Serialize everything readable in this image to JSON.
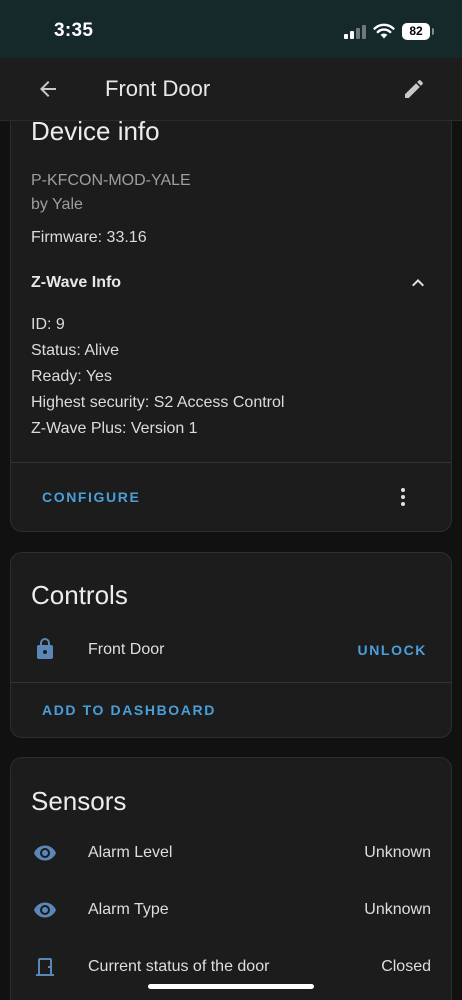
{
  "status_bar": {
    "time": "3:35",
    "battery": "82"
  },
  "app_bar": {
    "title": "Front Door",
    "back_icon": "arrow-left-icon",
    "edit_icon": "pencil-icon"
  },
  "device_info": {
    "heading": "Device info",
    "model": "P-KFCON-MOD-YALE",
    "manufacturer": "by Yale",
    "firmware": "Firmware: 33.16",
    "zwave": {
      "title": "Z-Wave Info",
      "expanded": true,
      "lines": [
        "ID: 9",
        "Status: Alive",
        "Ready: Yes",
        "Highest security: S2 Access Control",
        "Z-Wave Plus: Version 1"
      ]
    },
    "configure_label": "CONFIGURE",
    "more_icon": "dots-vertical-icon"
  },
  "controls": {
    "heading": "Controls",
    "entity": {
      "icon": "lock-icon",
      "name": "Front Door",
      "action_label": "UNLOCK"
    },
    "add_label": "ADD TO DASHBOARD"
  },
  "sensors": {
    "heading": "Sensors",
    "items": [
      {
        "icon": "eye-icon",
        "name": "Alarm Level",
        "value": "Unknown"
      },
      {
        "icon": "eye-icon",
        "name": "Alarm Type",
        "value": "Unknown"
      },
      {
        "icon": "door-closed-icon",
        "name": "Current status of the door",
        "value": "Closed"
      }
    ]
  },
  "colors": {
    "accent": "#4a9fdb",
    "icon": "#5b86b8",
    "card_bg": "#1c1c1c",
    "page_bg": "#111111",
    "status_bar_bg": "#15282a"
  }
}
